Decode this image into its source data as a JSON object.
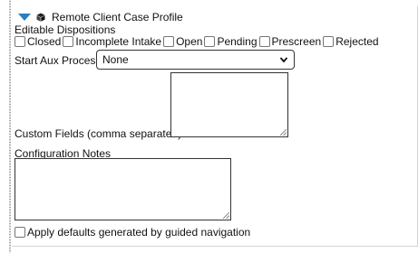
{
  "section": {
    "title": "Remote Client Case Profile",
    "toggle_icon": "triangle-down-icon",
    "type_icon": "cube-icon",
    "accent_color": "#2a7fc1"
  },
  "editable_dispositions": {
    "label": "Editable Dispositions",
    "options": [
      {
        "label": "Closed",
        "checked": false
      },
      {
        "label": "Incomplete Intake",
        "checked": false
      },
      {
        "label": "Open",
        "checked": false
      },
      {
        "label": "Pending",
        "checked": false
      },
      {
        "label": "Prescreen",
        "checked": false
      },
      {
        "label": "Rejected",
        "checked": false
      }
    ]
  },
  "start_aux_process": {
    "label": "Start Aux Process",
    "selected": "None"
  },
  "custom_fields": {
    "label": "Custom Fields (comma separated)",
    "value": ""
  },
  "configuration_notes": {
    "label": "Configuration Notes",
    "value": ""
  },
  "apply_defaults": {
    "label": "Apply defaults generated by guided navigation",
    "checked": false
  }
}
